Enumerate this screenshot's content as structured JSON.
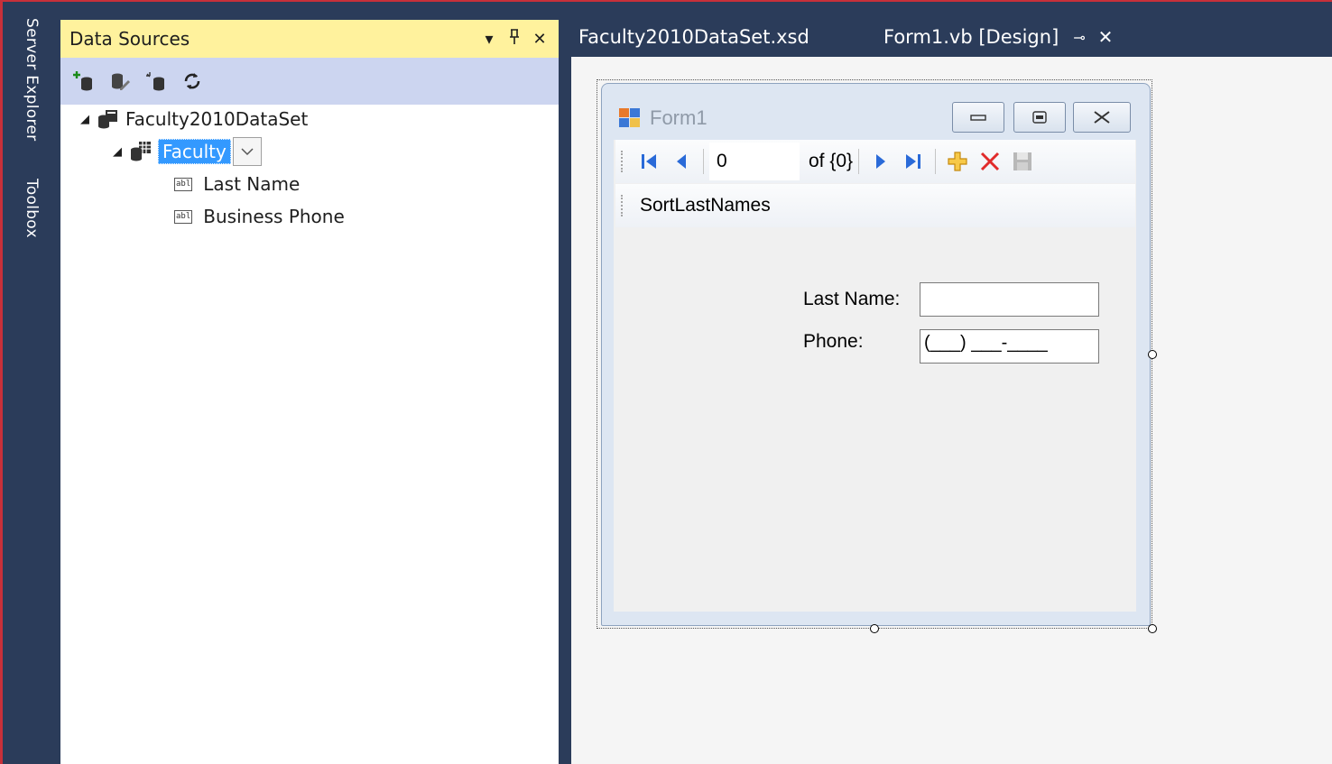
{
  "side_tabs": [
    "Server Explorer",
    "Toolbox"
  ],
  "data_sources": {
    "title": "Data Sources",
    "toolbar_icons": [
      "add-data-source-icon",
      "edit-dataset-icon",
      "configure-dataset-icon",
      "refresh-icon"
    ],
    "dataset": "Faculty2010DataSet",
    "table": "Faculty",
    "fields": [
      "Last Name",
      "Business Phone"
    ]
  },
  "tabs": [
    {
      "label": "Faculty2010DataSet.xsd",
      "active": false
    },
    {
      "label": "Form1.vb [Design]",
      "active": true
    }
  ],
  "form": {
    "title": "Form1",
    "navigator": {
      "position": "0",
      "count_label": "of {0}"
    },
    "menu_item": "SortLastNames",
    "last_name_label": "Last Name:",
    "phone_label": "Phone:",
    "phone_mask": "(___) ___-____"
  }
}
